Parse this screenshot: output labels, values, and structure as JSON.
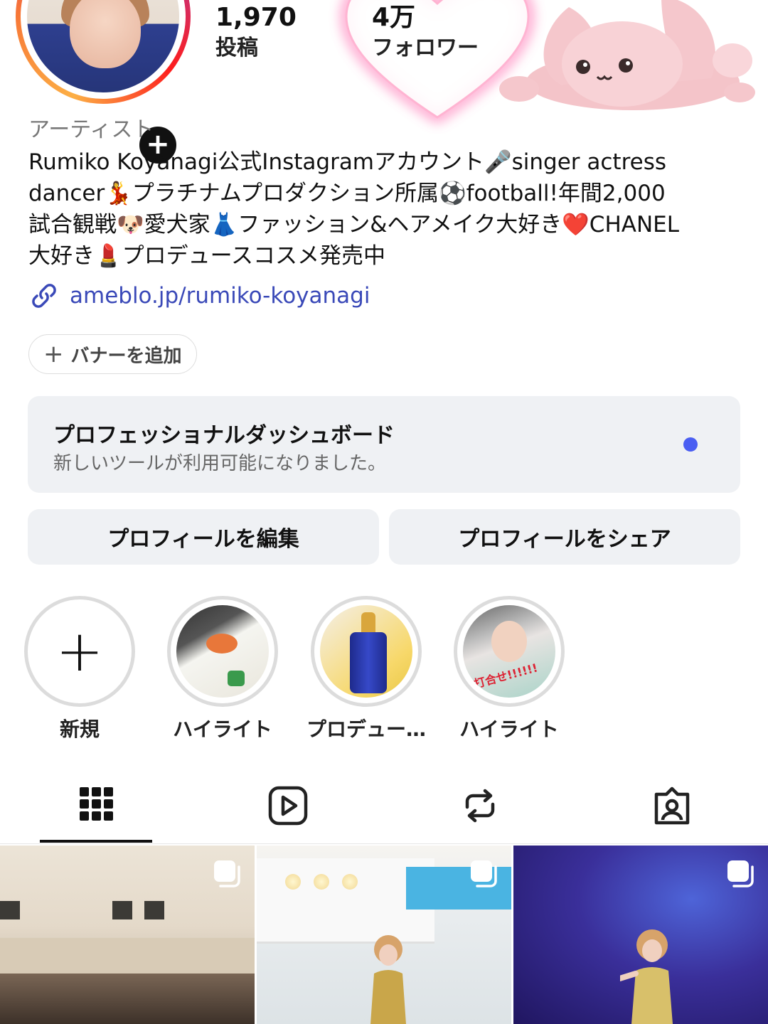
{
  "profile": {
    "stats": {
      "posts": {
        "value": "1,970",
        "label": "投稿"
      },
      "followers": {
        "value": "4万",
        "label": "フォロワー"
      }
    },
    "add_story_icon": "plus-icon"
  },
  "bio": {
    "category": "アーティスト",
    "lines": [
      "Rumiko Koyanagi公式Instagramアカウント🎤singer actress",
      "dancer💃プラチナムプロダクション所属⚽football!年間2,000",
      "試合観戦🐶愛犬家👗ファッション&ヘアメイク大好き❤️CHANEL",
      "大好き💄プロデュースコスメ発売中"
    ],
    "link_icon": "link-icon",
    "link": "ameblo.jp/rumiko-koyanagi"
  },
  "banner_button": {
    "icon": "+",
    "label": "バナーを追加"
  },
  "dashboard": {
    "title": "プロフェッショナルダッシュボード",
    "subtitle": "新しいツールが利用可能になりました。",
    "dot_color": "#4a5ef2"
  },
  "actions": {
    "edit": "プロフィールを編集",
    "share": "プロフィールをシェア"
  },
  "highlights": {
    "new": {
      "icon": "+",
      "label": "新規"
    },
    "items": [
      {
        "label": "ハイライト"
      },
      {
        "label": "プロデュー…"
      },
      {
        "label": "ハイライト",
        "overlay_text": "打合せ!!!!!!"
      }
    ]
  },
  "tabs": [
    {
      "icon": "grid-icon",
      "active": true
    },
    {
      "icon": "reels-icon",
      "active": false
    },
    {
      "icon": "repost-icon",
      "active": false
    },
    {
      "icon": "tagged-icon",
      "active": false
    }
  ],
  "posts": [
    {
      "type": "carousel",
      "icon": "multiple-images-icon"
    },
    {
      "type": "carousel",
      "icon": "multiple-images-icon"
    },
    {
      "type": "carousel",
      "icon": "multiple-images-icon"
    }
  ],
  "colors": {
    "link": "#3a49b8",
    "button_bg": "#eff1f4",
    "story_ring": [
      "#fcaf45",
      "#e1306c",
      "#c13584"
    ]
  }
}
